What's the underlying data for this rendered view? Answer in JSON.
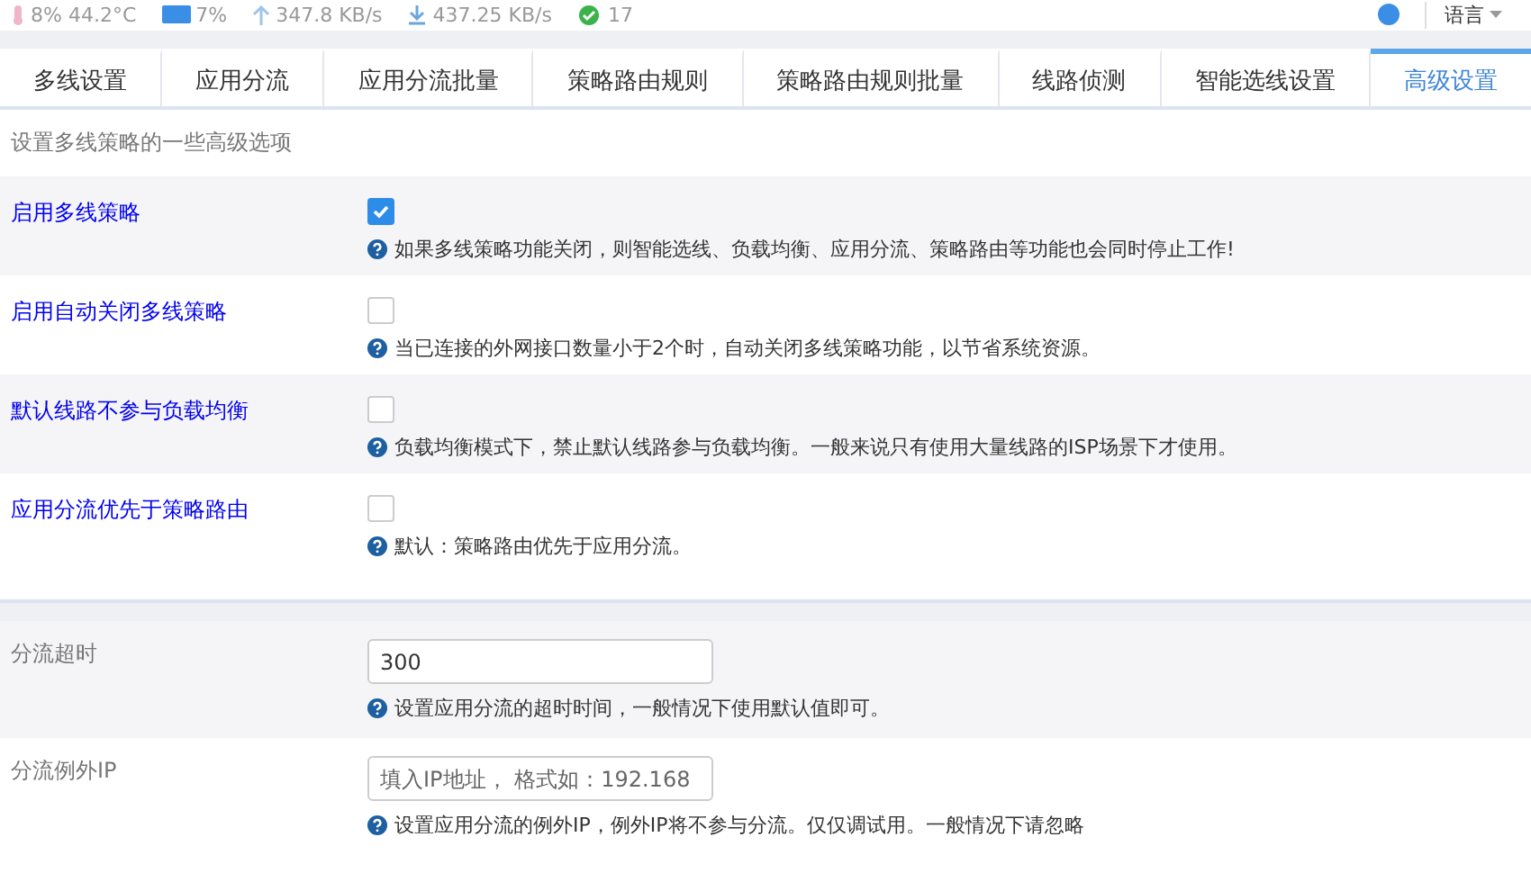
{
  "status_bar": {
    "items": [
      {
        "kind": "temp",
        "text": "8% 44.2°C"
      },
      {
        "kind": "memory",
        "text": "7%"
      },
      {
        "kind": "upload",
        "text": "347.8 KB/s"
      },
      {
        "kind": "download",
        "text": "437.25 KB/s"
      },
      {
        "kind": "online",
        "text": "17"
      }
    ],
    "language": "语言"
  },
  "tabs": [
    {
      "label": "多线设置",
      "selected": false
    },
    {
      "label": "应用分流",
      "selected": false
    },
    {
      "label": "应用分流批量",
      "selected": false
    },
    {
      "label": "策略路由规则",
      "selected": false
    },
    {
      "label": "策略路由规则批量",
      "selected": false
    },
    {
      "label": "线路侦测",
      "selected": false
    },
    {
      "label": "智能选线设置",
      "selected": false
    },
    {
      "label": "高级设置",
      "selected": true
    }
  ],
  "description": "设置多线策略的一些高级选项",
  "options": [
    {
      "label": "启用多线策略",
      "checked": true,
      "help": "如果多线策略功能关闭，则智能选线、负载均衡、应用分流、策略路由等功能也会同时停止工作!"
    },
    {
      "label": "启用自动关闭多线策略",
      "checked": false,
      "help": "当已连接的外网接口数量小于2个时，自动关闭多线策略功能，以节省系统资源。"
    },
    {
      "label": "默认线路不参与负载均衡",
      "checked": false,
      "help": "负载均衡模式下，禁止默认线路参与负载均衡。一般来说只有使用大量线路的ISP场景下才使用。"
    },
    {
      "label": "应用分流优先于策略路由",
      "checked": false,
      "help": "默认：策略路由优先于应用分流。"
    }
  ],
  "fields": [
    {
      "label": "分流超时",
      "value": "300",
      "help": "设置应用分流的超时时间，一般情况下使用默认值即可。"
    },
    {
      "label": "分流例外IP",
      "placeholder": "填入IP地址， 格式如：192.168",
      "help": "设置应用分流的例外IP，例外IP将不参与分流。仅仅调试用。一般情况下请忽略"
    }
  ]
}
